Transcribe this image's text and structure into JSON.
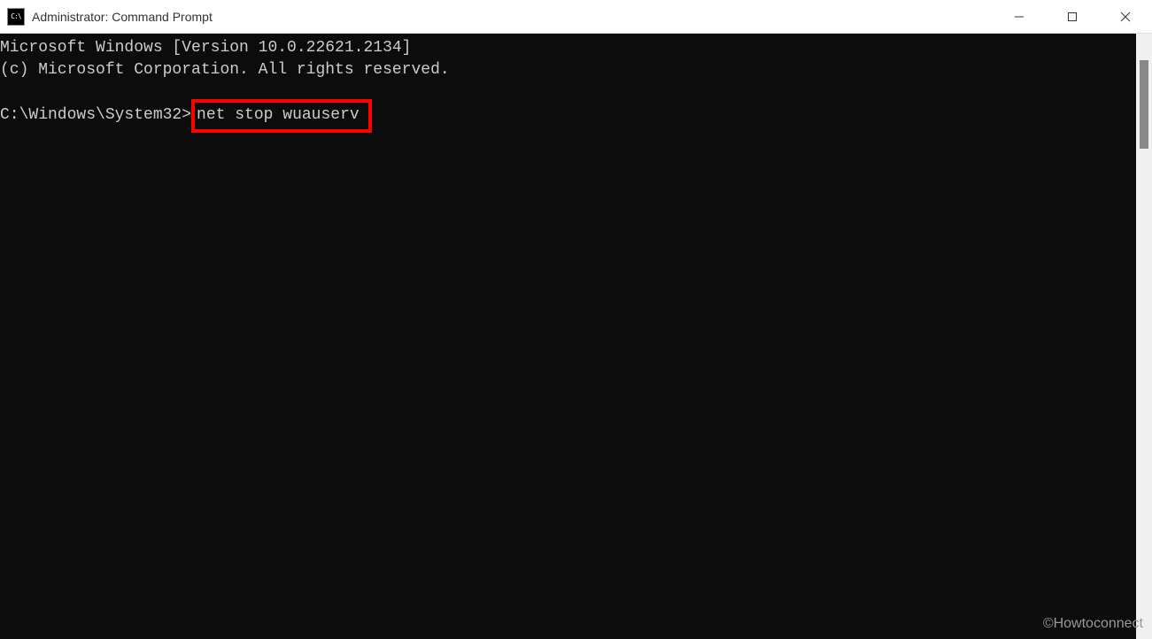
{
  "titlebar": {
    "icon_label": "CMD",
    "title": "Administrator: Command Prompt"
  },
  "terminal": {
    "line1": "Microsoft Windows [Version 10.0.22621.2134]",
    "line2": "(c) Microsoft Corporation. All rights reserved.",
    "prompt_prefix": "C:\\Windows\\System32>",
    "command": "net stop wuauserv"
  },
  "watermark": "©Howtoconnect"
}
